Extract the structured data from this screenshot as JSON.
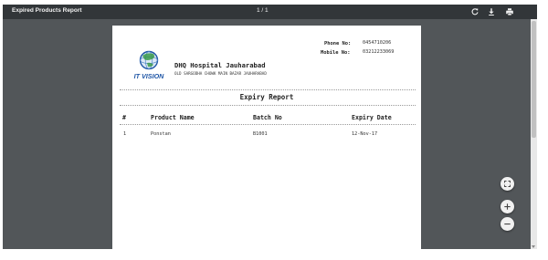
{
  "viewer": {
    "title": "Expired Products Report",
    "page_indicator": "1 / 1",
    "toolbar_icons": [
      "rotate-icon",
      "download-icon",
      "print-icon"
    ],
    "zoom_controls": [
      "fit-page-icon",
      "zoom-in-icon",
      "zoom-out-icon"
    ]
  },
  "report": {
    "logo": {
      "text": "IT VISION"
    },
    "hospital_name": "DHQ Hospital Jauharabad",
    "address": "OLD SARGODHA CHOWK MAIN BAZAR JAUHARABAD",
    "phone_label": "Phone No:",
    "phone_value": "0454710206",
    "mobile_label": "Mobile No:",
    "mobile_value": "03212233069",
    "title": "Expiry Report",
    "columns": [
      "#",
      "Product Name",
      "Batch No",
      "Expiry Date"
    ],
    "rows": [
      {
        "num": "1",
        "product": "Ponstan",
        "batch": "B1001",
        "expiry": "12-Nov-17"
      }
    ]
  },
  "colors": {
    "toolbar": "#323639",
    "viewer_bg": "#525659",
    "page": "#ffffff",
    "logo_blue": "#1f56a6"
  }
}
